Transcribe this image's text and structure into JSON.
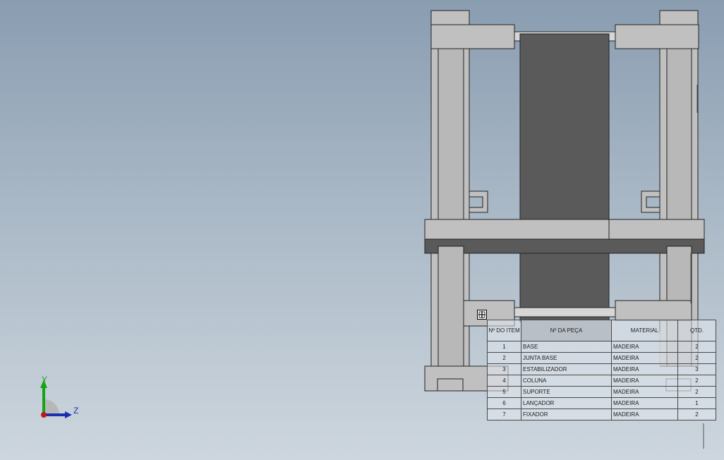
{
  "bom": {
    "headers": [
      "Nº DO ITEM",
      "Nº DA PEÇA",
      "MATERIAL",
      "QTD."
    ],
    "rows": [
      {
        "item": "1",
        "part": "BASE",
        "material": "MADEIRA",
        "qty": "2"
      },
      {
        "item": "2",
        "part": "JUNTA BASE",
        "material": "MADEIRA",
        "qty": "2"
      },
      {
        "item": "3",
        "part": "ESTABILIZADOR",
        "material": "MADEIRA",
        "qty": "3"
      },
      {
        "item": "4",
        "part": "COLUNA",
        "material": "MADEIRA",
        "qty": "2"
      },
      {
        "item": "5",
        "part": "SUPORTE",
        "material": "MADEIRA",
        "qty": "2"
      },
      {
        "item": "6",
        "part": "LANÇADOR",
        "material": "MADEIRA",
        "qty": "1"
      },
      {
        "item": "7",
        "part": "FIXADOR",
        "material": "MADEIRA",
        "qty": "2"
      }
    ]
  },
  "triad": {
    "y_label": "Y",
    "z_label": "Z"
  },
  "colors": {
    "part_fill": "#c0c0c0",
    "dark_part": "#5a5a5a",
    "edge": "#222222",
    "axis_y": "#16a316",
    "axis_z": "#1d2fb0",
    "axis_x": "#c01818"
  }
}
